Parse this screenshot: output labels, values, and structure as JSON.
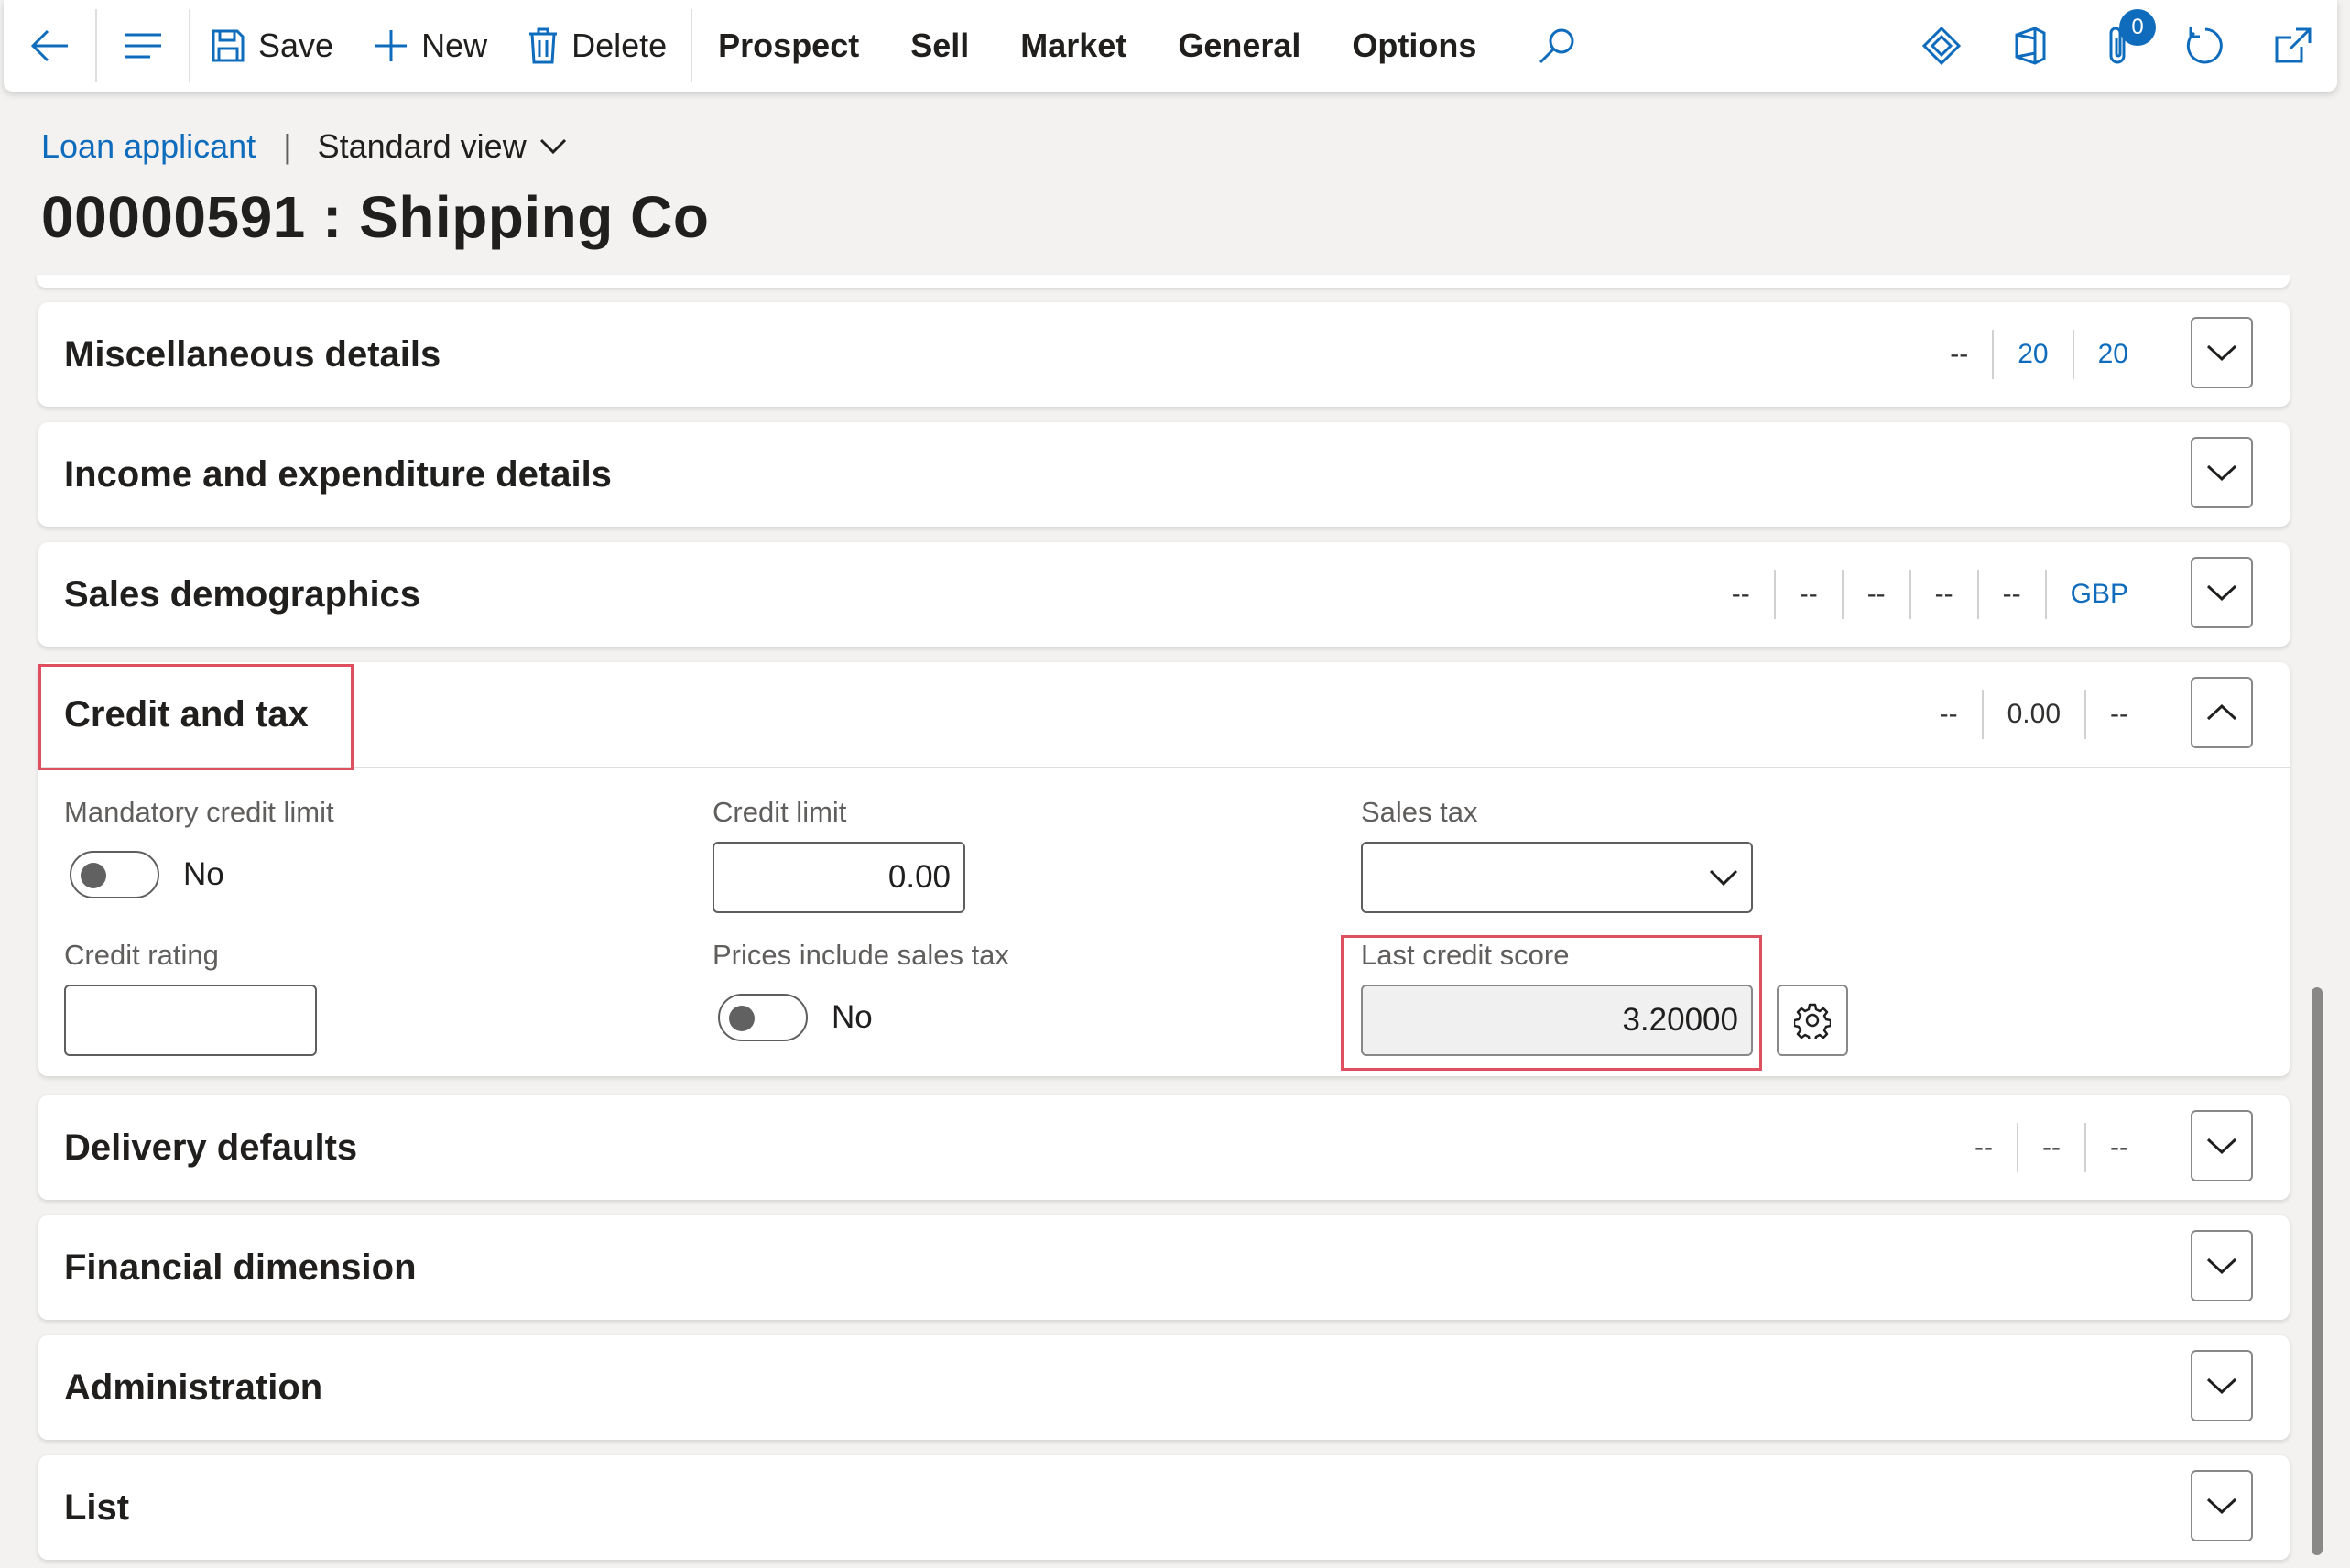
{
  "toolbar": {
    "save_label": "Save",
    "new_label": "New",
    "delete_label": "Delete",
    "menus": [
      "Prospect",
      "Sell",
      "Market",
      "General",
      "Options"
    ],
    "attachments_count": "0"
  },
  "breadcrumb": {
    "link": "Loan applicant",
    "separator": "|",
    "view": "Standard view"
  },
  "page_title": "00000591 : Shipping Co",
  "sections": {
    "misc": {
      "title": "Miscellaneous details",
      "summary": [
        "--",
        "20",
        "20"
      ]
    },
    "income": {
      "title": "Income and expenditure details"
    },
    "sales_demo": {
      "title": "Sales demographics",
      "summary": [
        "--",
        "--",
        "--",
        "--",
        "--",
        "GBP"
      ]
    },
    "credit": {
      "title": "Credit and tax",
      "summary": [
        "--",
        "0.00",
        "--"
      ],
      "mandatory_credit_limit_label": "Mandatory credit limit",
      "mandatory_credit_limit_value": "No",
      "credit_limit_label": "Credit limit",
      "credit_limit_value": "0.00",
      "sales_tax_label": "Sales tax",
      "sales_tax_value": "",
      "credit_rating_label": "Credit rating",
      "credit_rating_value": "",
      "prices_include_tax_label": "Prices include sales tax",
      "prices_include_tax_value": "No",
      "last_credit_score_label": "Last credit score",
      "last_credit_score_value": "3.20000"
    },
    "delivery": {
      "title": "Delivery defaults",
      "summary": [
        "--",
        "--",
        "--"
      ]
    },
    "financial": {
      "title": "Financial dimension"
    },
    "admin": {
      "title": "Administration"
    },
    "list": {
      "title": "List"
    }
  }
}
